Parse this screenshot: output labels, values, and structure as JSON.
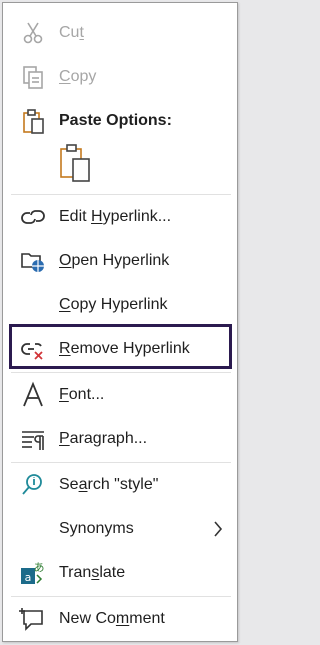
{
  "menu": {
    "cut": {
      "pre": "Cu",
      "key": "t",
      "post": ""
    },
    "copy": {
      "pre": "",
      "key": "C",
      "post": "opy"
    },
    "paste_options": {
      "label": "Paste Options:"
    },
    "edit_hyperlink": {
      "pre": "Edit ",
      "key": "H",
      "post": "yperlink..."
    },
    "open_hyperlink": {
      "pre": "",
      "key": "O",
      "post": "pen Hyperlink"
    },
    "copy_hyperlink": {
      "pre": "",
      "key": "C",
      "post": "opy Hyperlink"
    },
    "remove_hyperlink": {
      "pre": "",
      "key": "R",
      "post": "emove Hyperlink"
    },
    "font": {
      "pre": "",
      "key": "F",
      "post": "ont..."
    },
    "paragraph": {
      "pre": "",
      "key": "P",
      "post": "aragraph..."
    },
    "search": {
      "pre": "Se",
      "key": "a",
      "post": "rch \"style\""
    },
    "synonyms": {
      "pre": "Synonyms",
      "key": "",
      "post": ""
    },
    "translate": {
      "pre": "Tran",
      "key": "s",
      "post": "late"
    },
    "new_comment": {
      "pre": "New Co",
      "key": "m",
      "post": "ment"
    }
  },
  "colors": {
    "highlight_border": "#2b1a4f",
    "disabled_text": "#a6a6a6",
    "icon_blue": "#2b6cb0",
    "icon_orange": "#c47a1e",
    "icon_red": "#d13438"
  },
  "icons": [
    "scissors-icon",
    "copy-icon",
    "clipboard-icon",
    "paste-keep-source-icon",
    "link-icon",
    "open-link-icon",
    "remove-link-icon",
    "font-icon",
    "paragraph-icon",
    "search-icon",
    "chevron-right-icon",
    "translate-icon",
    "new-comment-icon"
  ]
}
